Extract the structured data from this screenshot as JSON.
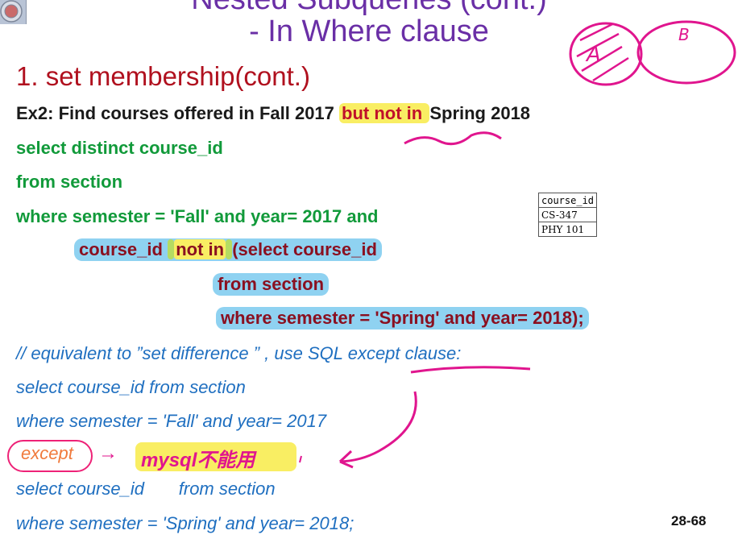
{
  "slide": {
    "title_line1": "Nested Subqueries (cont.)",
    "title_line2": "- In Where clause",
    "heading": "1. set membership(cont.)",
    "ex2_prefix": "Ex2: Find courses offered in Fall 2017 ",
    "ex2_highlight": "but not in ",
    "ex2_suffix": "Spring 2018",
    "sql1": {
      "line1": "select distinct course_id",
      "line2": "from section",
      "line3": "where semester = 'Fall' and year= 2017 and",
      "line4_a": "course_id",
      "line4_b": "not in",
      "line4_c": "(select course_id",
      "line5": "from section",
      "line6": "where semester = 'Spring' and year= 2018);"
    },
    "comment": "// equivalent to ”set difference ” , use SQL except clause:",
    "sql2": {
      "line1": "select course_id from section",
      "line2": "where semester = 'Fall' and year= 2017",
      "except": "except",
      "line4": "select course_id       from section",
      "line5": "where semester = 'Spring' and year= 2018;"
    },
    "annotation": {
      "arrow": "→",
      "mysql_note": "mysql不能用",
      "venn_a": "A",
      "venn_b": "B"
    },
    "result_table": {
      "header": "course_id",
      "rows": [
        "CS-347",
        "PHY 101"
      ]
    },
    "page_number": "28-68"
  },
  "colors": {
    "title": "#6a2fa6",
    "heading": "#b0101e",
    "sql_green": "#119a3a",
    "sql_maroon": "#8a1020",
    "highlight_blue": "#8fd2f1",
    "highlight_yellow": "#f9ee63",
    "comment_blue": "#1f6fc0",
    "ink_pink": "#e0158e"
  }
}
